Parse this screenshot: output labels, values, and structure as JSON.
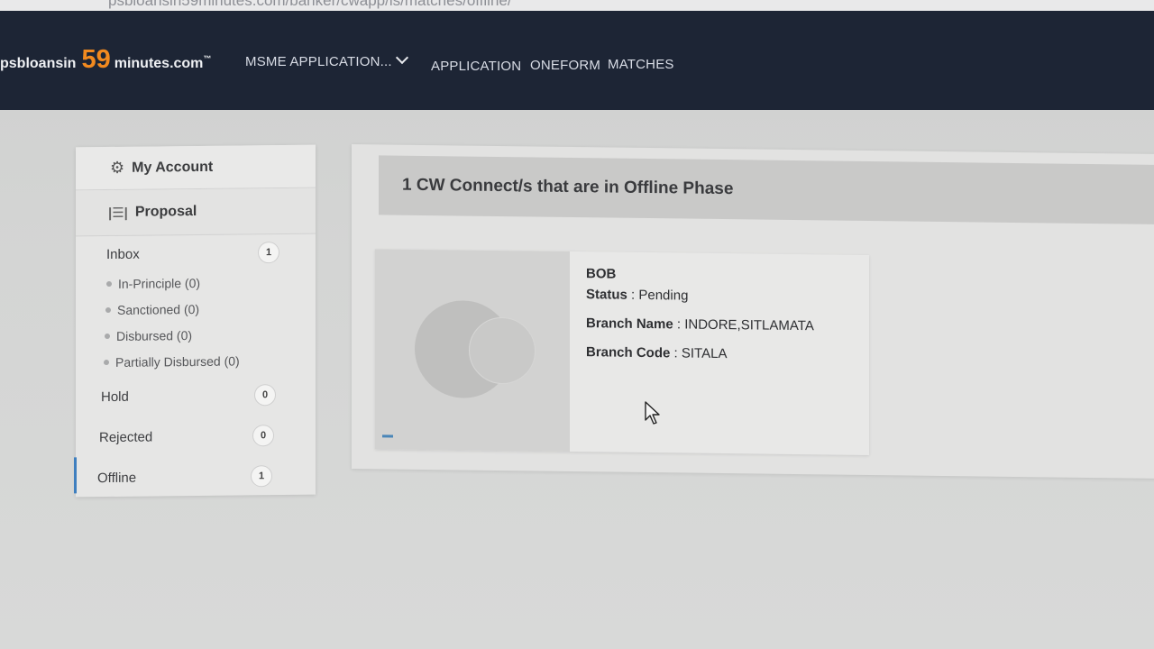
{
  "browser": {
    "url_fragment": "psbloansin59minutes.com/banker/cwapp/is/matches/offline/"
  },
  "navbar": {
    "brand_prefix": "psbloansin",
    "brand_number": "59",
    "brand_suffix": "minutes.com",
    "brand_tm": "™",
    "menu": [
      {
        "label": "MSME APPLICATION..."
      },
      {
        "label": "APPLICATION"
      },
      {
        "label": "ONEFORM"
      },
      {
        "label": "MATCHES"
      }
    ]
  },
  "sidebar": {
    "my_account": "My Account",
    "proposal": "Proposal",
    "inbox": {
      "label": "Inbox",
      "count": "1"
    },
    "sub_items": [
      {
        "label": "In-Principle (0)"
      },
      {
        "label": "Sanctioned (0)"
      },
      {
        "label": "Disbursed (0)"
      },
      {
        "label": "Partially Disbursed (0)"
      }
    ],
    "hold": {
      "label": "Hold",
      "count": "0"
    },
    "rejected": {
      "label": "Rejected",
      "count": "0"
    },
    "offline": {
      "label": "Offline",
      "count": "1"
    }
  },
  "main": {
    "header": "1 CW Connect/s that are in Offline Phase",
    "card": {
      "bank": "BOB",
      "status_label": "Status",
      "status_value": "Pending",
      "branch_name_label": "Branch Name",
      "branch_name_value": "INDORE,SITLAMATA",
      "branch_code_label": "Branch Code",
      "branch_code_value": "SITALA"
    }
  },
  "colors": {
    "navbar_bg": "#1d2535",
    "brand_accent": "#f28a1f",
    "active_indicator": "#3f7fbf"
  }
}
